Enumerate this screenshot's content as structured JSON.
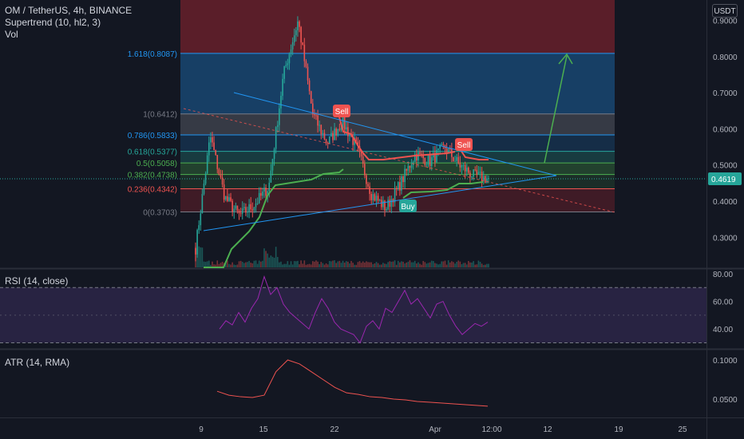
{
  "header": {
    "title": "OM / TetherUS, 4h, BINANCE",
    "indicator": "Supertrend (10, hl2, 3)",
    "vol_label": "Vol"
  },
  "currency_badge": "USDT",
  "current_price_label": "0.4619",
  "colors": {
    "background": "#131722",
    "up": "#26a69a",
    "down": "#ef5350",
    "supertrend_up": "#4caf50",
    "supertrend_down": "#ef5350",
    "rsi_line": "#9c27b0",
    "atr_line": "#ef5350",
    "trendline": "#2196f3"
  },
  "chart_data": [
    {
      "type": "line",
      "title": "OM / TetherUS, 4h, BINANCE",
      "y_axis_ticks": [
        "0.9000",
        "0.8000",
        "0.7000",
        "0.6000",
        "0.5000",
        "0.4000",
        "0.3000"
      ],
      "x_axis_ticks": [
        "9",
        "15",
        "22",
        "Apr",
        "12:00",
        "12",
        "19",
        "25"
      ],
      "fib_levels": [
        {
          "label": "1.618(0.8087)",
          "value": 0.8087
        },
        {
          "label": "1(0.6412)",
          "value": 0.6412
        },
        {
          "label": "0.786(0.5833)",
          "value": 0.5833
        },
        {
          "label": "0.618(0.5377)",
          "value": 0.5377
        },
        {
          "label": "0.5(0.5058)",
          "value": 0.5058
        },
        {
          "label": "0.382(0.4738)",
          "value": 0.4738
        },
        {
          "label": "0.236(0.4342)",
          "value": 0.4342
        },
        {
          "label": "0(0.3703)",
          "value": 0.3703
        }
      ],
      "signals": [
        {
          "label": "Sell",
          "value": 0.64
        },
        {
          "label": "Sell",
          "value": 0.545
        },
        {
          "label": "Buy",
          "value": 0.43
        }
      ],
      "price_path": [
        0.27,
        0.58,
        0.41,
        0.36,
        0.39,
        0.44,
        0.75,
        0.9,
        0.64,
        0.56,
        0.62,
        0.55,
        0.42,
        0.38,
        0.45,
        0.53,
        0.51,
        0.55,
        0.5,
        0.47,
        0.4619
      ],
      "current_price": 0.4619
    },
    {
      "type": "line",
      "title": "RSI (14, close)",
      "y_axis_ticks": [
        "80.00",
        "60.00",
        "40.00"
      ],
      "band": [
        30,
        70
      ],
      "values": [
        40,
        46,
        43,
        52,
        45,
        55,
        62,
        78,
        65,
        70,
        58,
        52,
        48,
        44,
        40,
        52,
        62,
        55,
        45,
        40,
        38,
        36,
        30,
        42,
        46,
        40,
        55,
        52,
        60,
        68,
        58,
        62,
        55,
        48,
        58,
        60,
        50,
        42,
        36,
        40,
        44,
        42,
        45
      ]
    },
    {
      "type": "line",
      "title": "ATR (14, RMA)",
      "y_axis_ticks": [
        "0.1000",
        "0.0500"
      ],
      "values": [
        0.06,
        0.055,
        0.053,
        0.052,
        0.055,
        0.085,
        0.1,
        0.095,
        0.085,
        0.075,
        0.065,
        0.058,
        0.056,
        0.053,
        0.052,
        0.05,
        0.049,
        0.047,
        0.046,
        0.045,
        0.044,
        0.043,
        0.042,
        0.041
      ]
    }
  ]
}
